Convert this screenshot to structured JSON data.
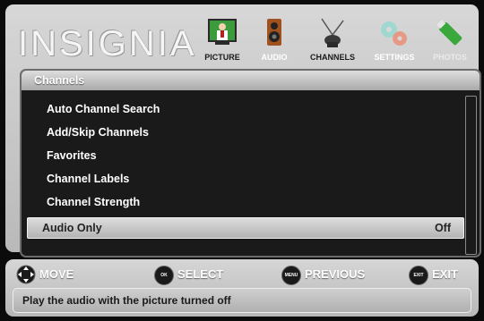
{
  "brand": {
    "logo_text": "INSIGNIA"
  },
  "tabs": [
    {
      "label": "PICTURE",
      "icon": "tv-icon",
      "state": "active"
    },
    {
      "label": "AUDIO",
      "icon": "speaker-icon",
      "state": "normal"
    },
    {
      "label": "CHANNELS",
      "icon": "antenna-icon",
      "state": "selected"
    },
    {
      "label": "SETTINGS",
      "icon": "gears-icon",
      "state": "normal"
    },
    {
      "label": "PHOTOS",
      "icon": "usb-drive-icon",
      "state": "dim"
    }
  ],
  "content": {
    "title": "Channels",
    "items": [
      {
        "label": "Auto Channel Search",
        "value": ""
      },
      {
        "label": "Add/Skip Channels",
        "value": ""
      },
      {
        "label": "Favorites",
        "value": ""
      },
      {
        "label": "Channel Labels",
        "value": ""
      },
      {
        "label": "Channel Strength",
        "value": ""
      },
      {
        "label": "Audio Only",
        "value": "Off",
        "selected": true
      }
    ]
  },
  "footer": {
    "hints": [
      {
        "button": "",
        "label": "MOVE",
        "icon": "dpad-icon"
      },
      {
        "button": "OK ENTER",
        "label": "SELECT",
        "icon": "ok-button-icon"
      },
      {
        "button": "MENU",
        "label": "PREVIOUS",
        "icon": "menu-button-icon"
      },
      {
        "button": "EXIT",
        "label": "EXIT",
        "icon": "exit-button-icon"
      }
    ],
    "description": "Play the audio with the picture turned off"
  },
  "colors": {
    "panel": "#c8c8c8",
    "content_bg": "#1a1a1a",
    "text": "#ffffff"
  }
}
